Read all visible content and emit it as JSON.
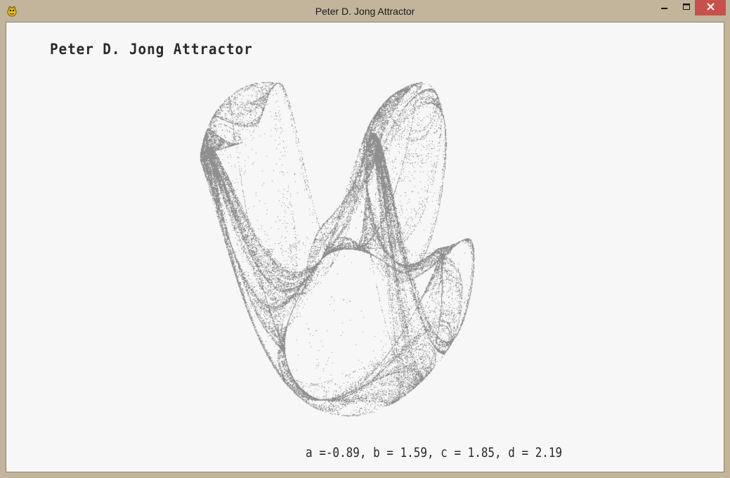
{
  "window": {
    "title": "Peter D. Jong Attractor",
    "icon": "pygame-snake-icon",
    "controls": {
      "minimize": "minimize-icon",
      "maximize": "maximize-icon",
      "close": "close-icon",
      "close_color": "#c7504a"
    }
  },
  "canvas": {
    "heading": "Peter D. Jong Attractor",
    "parameters_text": "a =-0.89, b = 1.59, c = 1.85, d = 2.19",
    "parameters": {
      "a": -0.89,
      "b": 1.59,
      "c": 1.85,
      "d": 2.19
    },
    "background_color": "#f7f7f7",
    "point_color": "#8f8f8f"
  }
}
